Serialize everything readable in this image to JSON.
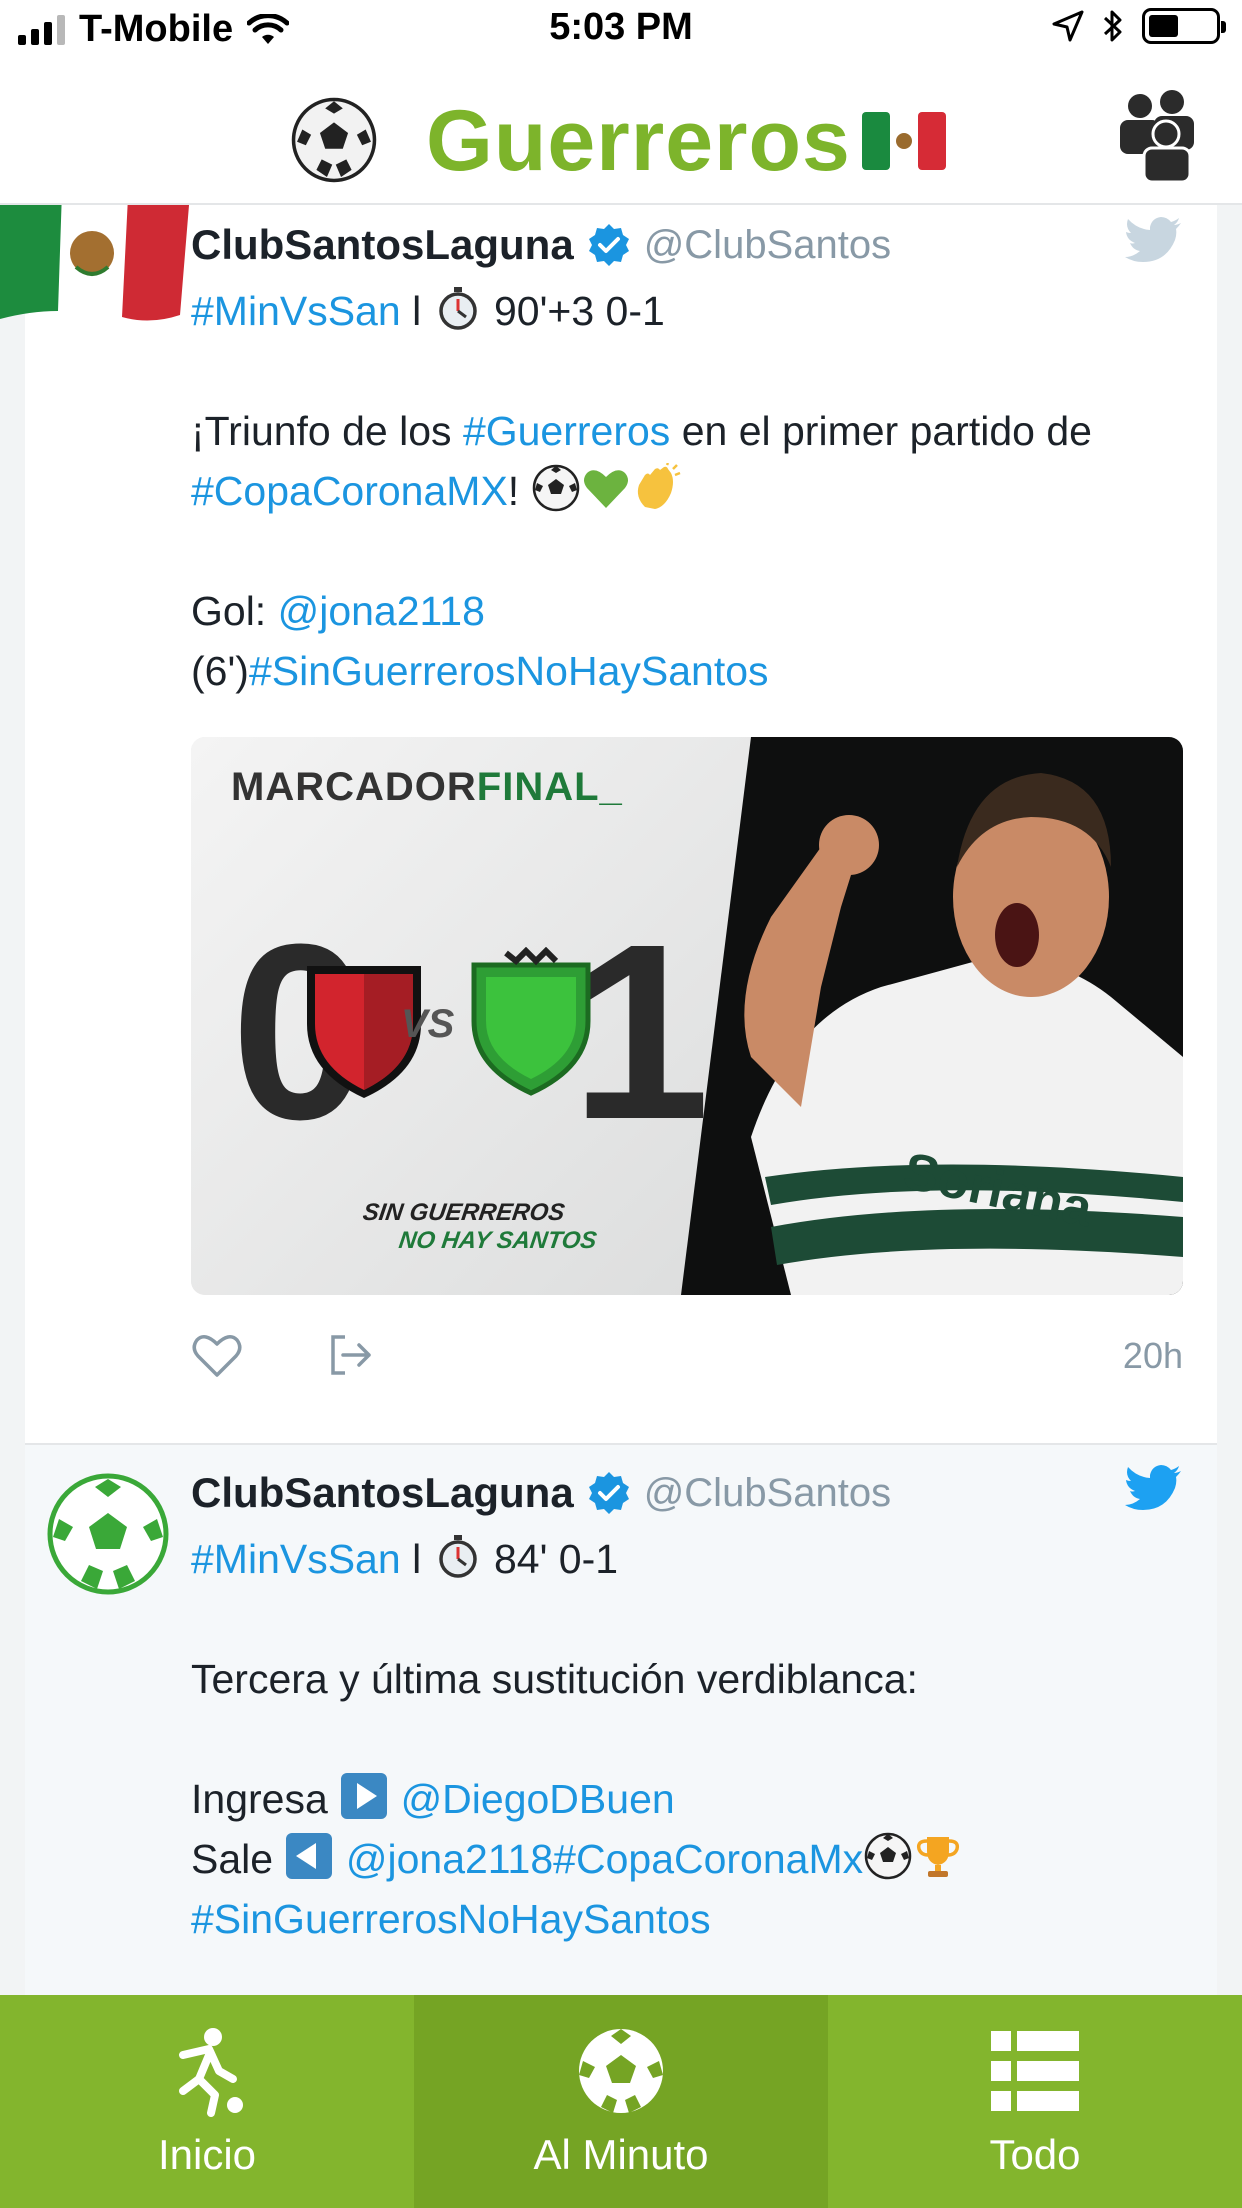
{
  "status_bar": {
    "carrier": "T-Mobile",
    "time": "5:03 PM"
  },
  "header": {
    "title": "Guerreros",
    "icons": [
      "soccer-ball-emoji",
      "mexico-flag-emoji",
      "group-icon"
    ]
  },
  "tweets": [
    {
      "name": "ClubSantosLaguna",
      "handle": "@ClubSantos",
      "line1_tag": "#MinVsSan",
      "line1_sep": " l ",
      "line1_rest": " 90'+3 0-1",
      "text_a": "¡Triunfo de los ",
      "tag_guerreros": "#Guerreros",
      "text_b": " en el primer partido de ",
      "tag_copa": "#CopaCoronaMX",
      "text_c": "! ",
      "gol_label": "Gol: ",
      "gol_user": "@jona2118",
      "gol_minute": "(6')",
      "tag_sin": "#SinGuerrerosNoHaySantos",
      "media": {
        "label_a": "MARCADOR",
        "label_b": "FINAL_",
        "score_home": "0",
        "vs": "VS",
        "score_away": "1",
        "slogan_a": "SIN GUERREROS",
        "slogan_b": "NO HAY SANTOS"
      },
      "time": "20h"
    },
    {
      "name": "ClubSantosLaguna",
      "handle": "@ClubSantos",
      "line1_tag": "#MinVsSan",
      "line1_sep": " l ",
      "line1_rest": " 84' 0-1",
      "text_a": "Tercera y última sustitución verdiblanca:",
      "ingresa": "Ingresa ",
      "ingresa_user": "@DiegoDBuen",
      "sale": "Sale ",
      "sale_user": "@jona2118",
      "tag_copa": "#CopaCoronaMx",
      "tag_sin": "#SinGuerrerosNoHaySantos"
    }
  ],
  "tabs": [
    {
      "label": "Inicio",
      "icon": "runner-icon"
    },
    {
      "label": "Al Minuto",
      "icon": "soccer-ball-icon"
    },
    {
      "label": "Todo",
      "icon": "list-icon"
    }
  ],
  "colors": {
    "brand_green": "#7db42b",
    "tab_bar": "#83b52d",
    "tab_active": "#75a424",
    "link": "#1b95e0",
    "handle_gray": "#8899a6"
  }
}
